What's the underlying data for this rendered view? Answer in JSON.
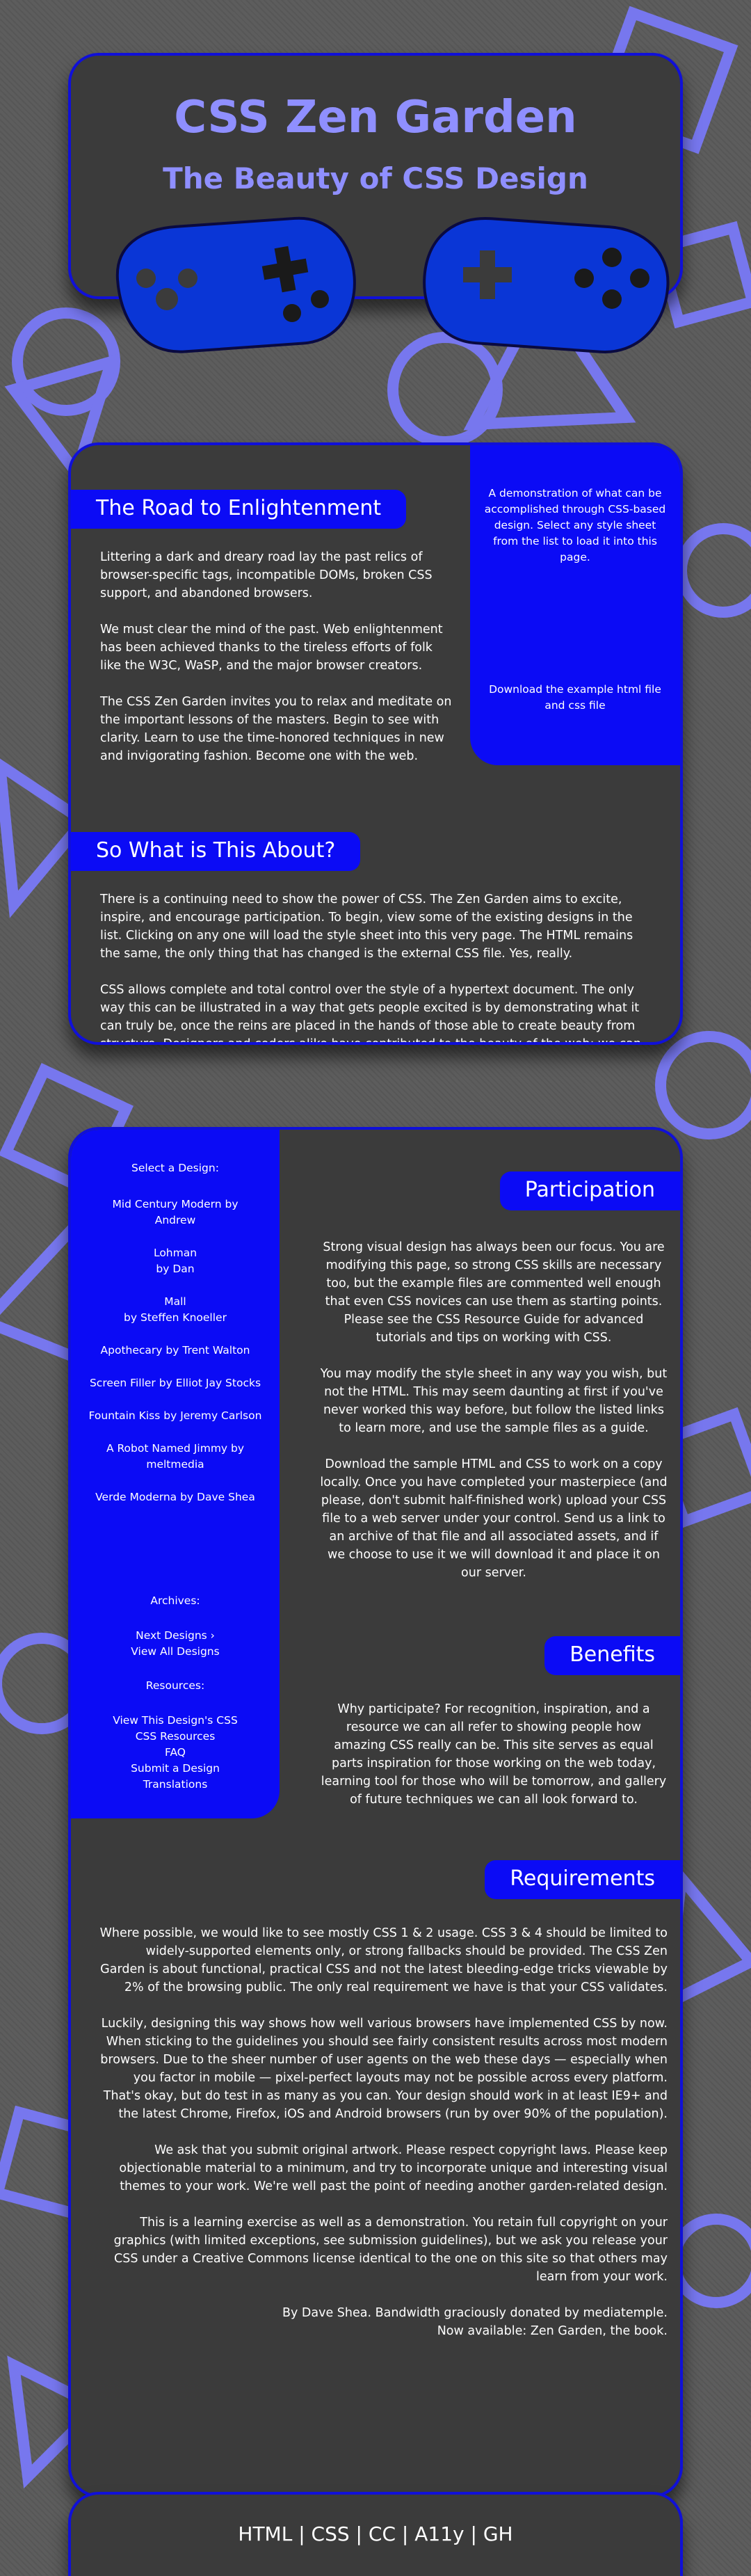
{
  "header": {
    "title": "CSS Zen Garden",
    "tagline": "The Beauty of CSS Design"
  },
  "colors": {
    "accent": "#0b0bf5",
    "title": "#8f8fff",
    "card": "#3b3b3b",
    "shape": "#7b7bff"
  },
  "intro": {
    "preamble_heading": "The Road to Enlightenment",
    "preamble_paragraphs": [
      "Littering a dark and dreary road lay the past relics of browser-specific tags, incompatible DOMs, broken CSS support, and abandoned browsers.",
      "We must clear the mind of the past. Web enlightenment has been achieved thanks to the tireless efforts of folk like the W3C, WaSP, and the major browser creators.",
      "The CSS Zen Garden invites you to relax and meditate on the important lessons of the masters. Begin to see with clarity. Learn to use the time-honored techniques in new and invigorating fashion. Become one with the web."
    ],
    "summary_text": "A demonstration of what can be accomplished through CSS-based design. Select any style sheet from the list to load it into this page.",
    "download_text": "Download the example html file and css file",
    "explanation_heading": "So What is This About?",
    "explanation_paragraphs": [
      "There is a continuing need to show the power of CSS. The Zen Garden aims to excite, inspire, and encourage participation. To begin, view some of the existing designs in the list. Clicking on any one will load the style sheet into this very page. The HTML remains the same, the only thing that has changed is the external CSS file. Yes, really.",
      "CSS allows complete and total control over the style of a hypertext document. The only way this can be illustrated in a way that gets people excited is by demonstrating what it can truly be, once the reins are placed in the hands of those able to create beauty from structure. Designers and coders alike have contributed to the beauty of the web; we can always push it further."
    ]
  },
  "sidebar": {
    "select_heading": "Select a Design:",
    "designs": [
      {
        "name": "Mid Century Modern",
        "author": "Andrew"
      },
      {
        "name": "Lohman",
        "author": "Dan"
      },
      {
        "name": "Mall",
        "author": "Steffen Knoeller"
      },
      {
        "name": "Apothecary",
        "author": "Trent Walton"
      },
      {
        "name": "Screen Filler",
        "author": "Elliot Jay Stocks"
      },
      {
        "name": "Fountain Kiss",
        "author": "Jeremy Carlson"
      },
      {
        "name": "A Robot Named Jimmy",
        "author": "meltmedia"
      },
      {
        "name": "Verde Moderna",
        "author": "Dave Shea"
      }
    ],
    "by_word": "by",
    "archives_heading": "Archives:",
    "next_designs": "Next Designs ›",
    "view_all": "View All Designs",
    "resources_heading": "Resources:",
    "resources": [
      "View This Design's CSS",
      "CSS Resources",
      "FAQ",
      "Submit a Design",
      "Translations"
    ]
  },
  "main": {
    "participation_heading": "Participation",
    "participation_paragraphs": [
      "Strong visual design has always been our focus. You are modifying this page, so strong CSS skills are necessary too, but the example files are commented well enough that even CSS novices can use them as starting points. Please see the CSS Resource Guide for advanced tutorials and tips on working with CSS.",
      "You may modify the style sheet in any way you wish, but not the HTML. This may seem daunting at first if you've never worked this way before, but follow the listed links to learn more, and use the sample files as a guide.",
      "Download the sample HTML and CSS to work on a copy locally. Once you have completed your masterpiece (and please, don't submit half-finished work) upload your CSS file to a web server under your control. Send us a link to an archive of that file and all associated assets, and if we choose to use it we will download it and place it on our server."
    ],
    "benefits_heading": "Benefits",
    "benefits_paragraphs": [
      "Why participate? For recognition, inspiration, and a resource we can all refer to showing people how amazing CSS really can be. This site serves as equal parts inspiration for those working on the web today, learning tool for those who will be tomorrow, and gallery of future techniques we can all look forward to."
    ],
    "requirements_heading": "Requirements",
    "requirements_paragraphs": [
      "Where possible, we would like to see mostly CSS 1 & 2 usage. CSS 3 & 4 should be limited to widely-supported elements only, or strong fallbacks should be provided. The CSS Zen Garden is about functional, practical CSS and not the latest bleeding-edge tricks viewable by 2% of the browsing public. The only real requirement we have is that your CSS validates.",
      "Luckily, designing this way shows how well various browsers have implemented CSS by now. When sticking to the guidelines you should see fairly consistent results across most modern browsers. Due to the sheer number of user agents on the web these days — especially when you factor in mobile — pixel-perfect layouts may not be possible across every platform. That's okay, but do test in as many as you can. Your design should work in at least IE9+ and the latest Chrome, Firefox, iOS and Android browsers (run by over 90% of the population).",
      "We ask that you submit original artwork. Please respect copyright laws. Please keep objectionable material to a minimum, and try to incorporate unique and interesting visual themes to your work. We're well past the point of needing another garden-related design.",
      "This is a learning exercise as well as a demonstration. You retain full copyright on your graphics (with limited exceptions, see submission guidelines), but we ask you release your CSS under a Creative Commons license identical to the one on this site so that others may learn from your work."
    ],
    "credits_line1": "By Dave Shea. Bandwidth graciously donated by mediatemple.",
    "credits_line2": "Now available: Zen Garden, the book."
  },
  "footer": {
    "links": [
      "HTML",
      "CSS",
      "CC",
      "A11y",
      "GH"
    ],
    "separator": " | "
  }
}
